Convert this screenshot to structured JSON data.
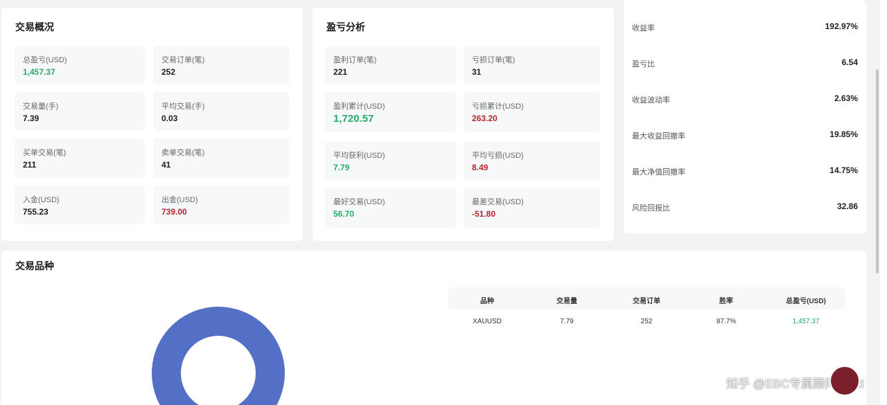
{
  "overview": {
    "title": "交易概况",
    "tiles": [
      {
        "label": "总盈亏(USD)",
        "value": "1,457.37",
        "tone": "green"
      },
      {
        "label": "交易订单(笔)",
        "value": "252",
        "tone": ""
      },
      {
        "label": "交易量(手)",
        "value": "7.39",
        "tone": ""
      },
      {
        "label": "平均交易(手)",
        "value": "0.03",
        "tone": ""
      },
      {
        "label": "买单交易(笔)",
        "value": "211",
        "tone": ""
      },
      {
        "label": "卖单交易(笔)",
        "value": "41",
        "tone": ""
      },
      {
        "label": "入金(USD)",
        "value": "755.23",
        "tone": ""
      },
      {
        "label": "出金(USD)",
        "value": "739.00",
        "tone": "red"
      }
    ]
  },
  "pnl": {
    "title": "盈亏分析",
    "tiles": [
      {
        "label": "盈利订单(笔)",
        "value": "221",
        "tone": ""
      },
      {
        "label": "亏损订单(笔)",
        "value": "31",
        "tone": ""
      },
      {
        "label": "盈利累计(USD)",
        "value": "1,720.57",
        "tone": "green"
      },
      {
        "label": "亏损累计(USD)",
        "value": "263.20",
        "tone": "red"
      },
      {
        "label": "平均获利(USD)",
        "value": "7.79",
        "tone": "green"
      },
      {
        "label": "平均亏损(USD)",
        "value": "8.49",
        "tone": "red"
      },
      {
        "label": "最好交易(USD)",
        "value": "56.70",
        "tone": "green"
      },
      {
        "label": "最差交易(USD)",
        "value": "-51.80",
        "tone": "red"
      }
    ]
  },
  "ratios": [
    {
      "label": "收益率",
      "value": "192.97%"
    },
    {
      "label": "盈亏比",
      "value": "6.54"
    },
    {
      "label": "收益波动率",
      "value": "2.63%"
    },
    {
      "label": "最大收益回撤率",
      "value": "19.85%"
    },
    {
      "label": "最大净值回撤率",
      "value": "14.75%"
    },
    {
      "label": "风险回报比",
      "value": "32.86"
    }
  ],
  "symbols": {
    "title": "交易品种",
    "headers": [
      "品种",
      "交易量",
      "交易订单",
      "胜率",
      "总盈亏(USD)"
    ],
    "rows": [
      [
        "XAUUSD",
        "7.79",
        "252",
        "87.7%",
        "1,457.37"
      ]
    ],
    "donut_color": "#5470c6",
    "donut_share": 1.0
  },
  "colors": {
    "positive": "#2aa86c",
    "negative": "#b3262f"
  },
  "watermark": "知乎 @EBC专属顾问Bond"
}
